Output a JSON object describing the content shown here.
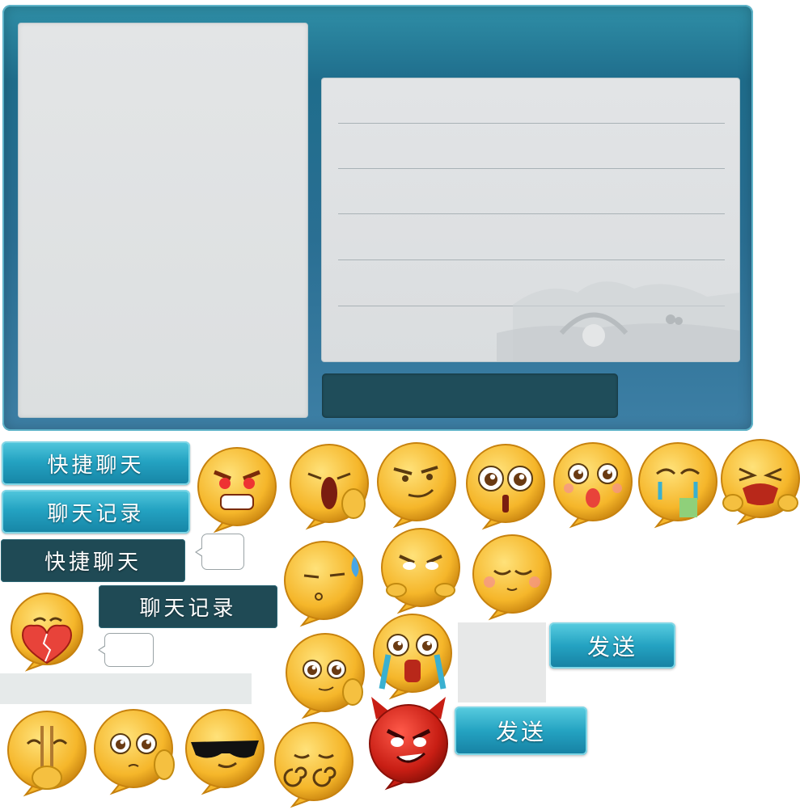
{
  "tabs": {
    "quick_chat": "快捷聊天",
    "chat_history": "聊天记录"
  },
  "send": {
    "label": "发送"
  },
  "emojis": [
    "angry",
    "yawn",
    "smirk",
    "shocked",
    "kiss",
    "drool",
    "crying",
    "sleepy-sweat",
    "peek",
    "shy",
    "heartbroken",
    "wink-thumb",
    "tears-shock",
    "devil",
    "praying",
    "wave",
    "cool",
    "dizzy"
  ],
  "colors": {
    "panel": "#2a6f93",
    "tab_light": "#24a3c2",
    "tab_dark": "#1f4a55",
    "input_bar": "#1f4d5a"
  }
}
